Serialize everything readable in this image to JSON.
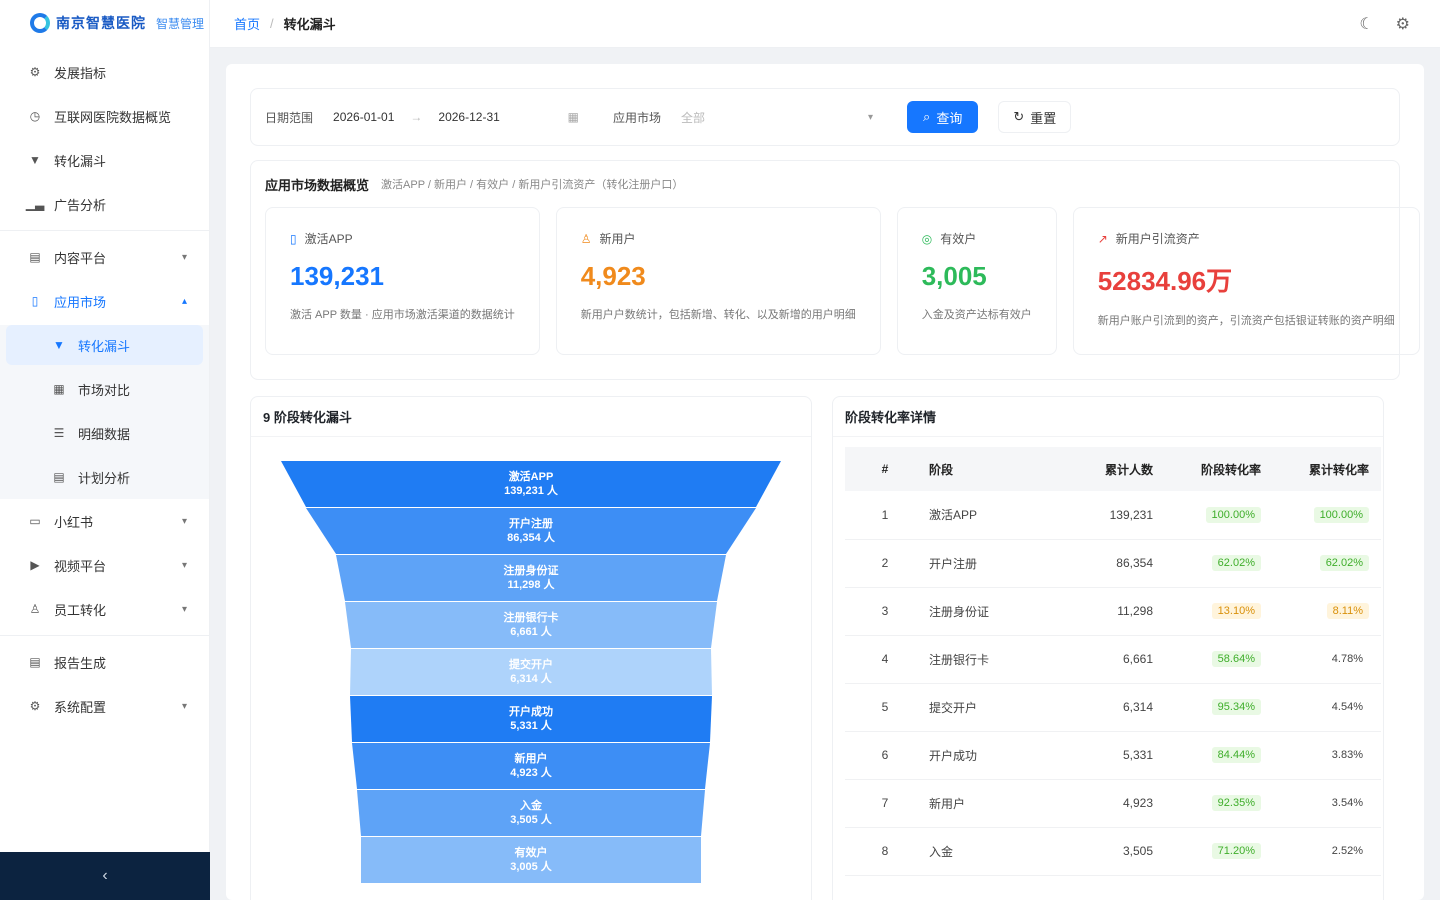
{
  "brand": {
    "name": "南京智慧医院",
    "sub": "智慧管理"
  },
  "sidebar": {
    "items": [
      {
        "label": "发展指标",
        "icon": "gear-icon"
      },
      {
        "label": "互联网医院数据概览",
        "icon": "clock-icon"
      },
      {
        "label": "转化漏斗",
        "icon": "funnel-icon"
      },
      {
        "label": "广告分析",
        "icon": "chart-icon"
      },
      {
        "label": "内容平台",
        "icon": "doc-icon"
      },
      {
        "label": "应用市场",
        "icon": "phone-icon"
      },
      {
        "label": "转化漏斗",
        "icon": "funnel-icon"
      },
      {
        "label": "市场对比",
        "icon": "grid-icon"
      },
      {
        "label": "明细数据",
        "icon": "list-icon"
      },
      {
        "label": "计划分析",
        "icon": "doc-icon"
      },
      {
        "label": "小红书",
        "icon": "book-icon"
      },
      {
        "label": "视频平台",
        "icon": "video-icon"
      },
      {
        "label": "员工转化",
        "icon": "user-icon"
      },
      {
        "label": "报告生成",
        "icon": "doc-icon"
      },
      {
        "label": "系统配置",
        "icon": "gear-icon"
      }
    ]
  },
  "header": {
    "home": "首页",
    "current": "转化漏斗"
  },
  "filter": {
    "date_label": "日期范围",
    "start": "2026-01-01",
    "end": "2026-12-31",
    "market_label": "应用市场",
    "market_placeholder": "全部",
    "query": "查询",
    "reset": "重置"
  },
  "overview": {
    "title": "应用市场数据概览",
    "desc": "激活APP / 新用户 / 有效户 / 新用户引流资产（转化注册户口）",
    "cards": [
      {
        "label": "激活APP",
        "value": "139,231",
        "color": "#1677ff",
        "icon": "phone-icon",
        "desc": "激活 APP 数量 · 应用市场激活渠道的数据统计"
      },
      {
        "label": "新用户",
        "value": "4,923",
        "color": "#f08a1c",
        "icon": "user-icon",
        "desc": "新用户户数统计，包括新增、转化、以及新增的用户明细"
      },
      {
        "label": "有效户",
        "value": "3,005",
        "color": "#2dba5a",
        "icon": "check-icon",
        "desc": "入金及资产达标有效户"
      },
      {
        "label": "新用户引流资产",
        "value": "52834.96万",
        "color": "#e8403c",
        "icon": "trend-icon",
        "desc": "新用户账户引流到的资产，引流资产包括银证转账的资产明细"
      }
    ]
  },
  "funnel": {
    "title": "9 阶段转化漏斗",
    "stages": [
      {
        "name": "激活APP",
        "count": "139,231 人"
      },
      {
        "name": "开户注册",
        "count": "86,354 人"
      },
      {
        "name": "注册身份证",
        "count": "11,298 人"
      },
      {
        "name": "注册银行卡",
        "count": "6,661 人"
      },
      {
        "name": "提交开户",
        "count": "6,314 人"
      },
      {
        "name": "开户成功",
        "count": "5,331 人"
      },
      {
        "name": "新用户",
        "count": "4,923 人"
      },
      {
        "name": "入金",
        "count": "3,505 人"
      },
      {
        "name": "有效户",
        "count": "3,005 人"
      }
    ]
  },
  "table": {
    "title": "阶段转化率详情",
    "headers": [
      "#",
      "阶段",
      "累计人数",
      "阶段转化率",
      "累计转化率"
    ],
    "rows": [
      {
        "n": "1",
        "stage": "激活APP",
        "count": "139,231",
        "rate": "100.00%",
        "cum": "100.00%"
      },
      {
        "n": "2",
        "stage": "开户注册",
        "count": "86,354",
        "rate": "62.02%",
        "cum": "62.02%"
      },
      {
        "n": "3",
        "stage": "注册身份证",
        "count": "11,298",
        "rate": "13.10%",
        "cum": "8.11%"
      },
      {
        "n": "4",
        "stage": "注册银行卡",
        "count": "6,661",
        "rate": "58.64%",
        "cum": "4.78%"
      },
      {
        "n": "5",
        "stage": "提交开户",
        "count": "6,314",
        "rate": "95.34%",
        "cum": "4.54%"
      },
      {
        "n": "6",
        "stage": "开户成功",
        "count": "5,331",
        "rate": "84.44%",
        "cum": "3.83%"
      },
      {
        "n": "7",
        "stage": "新用户",
        "count": "4,923",
        "rate": "92.35%",
        "cum": "3.54%"
      },
      {
        "n": "8",
        "stage": "入金",
        "count": "3,505",
        "rate": "71.20%",
        "cum": "2.52%"
      }
    ]
  },
  "colors": {
    "primary": "#1677ff",
    "sidebar_bottom": "#0c2340"
  }
}
